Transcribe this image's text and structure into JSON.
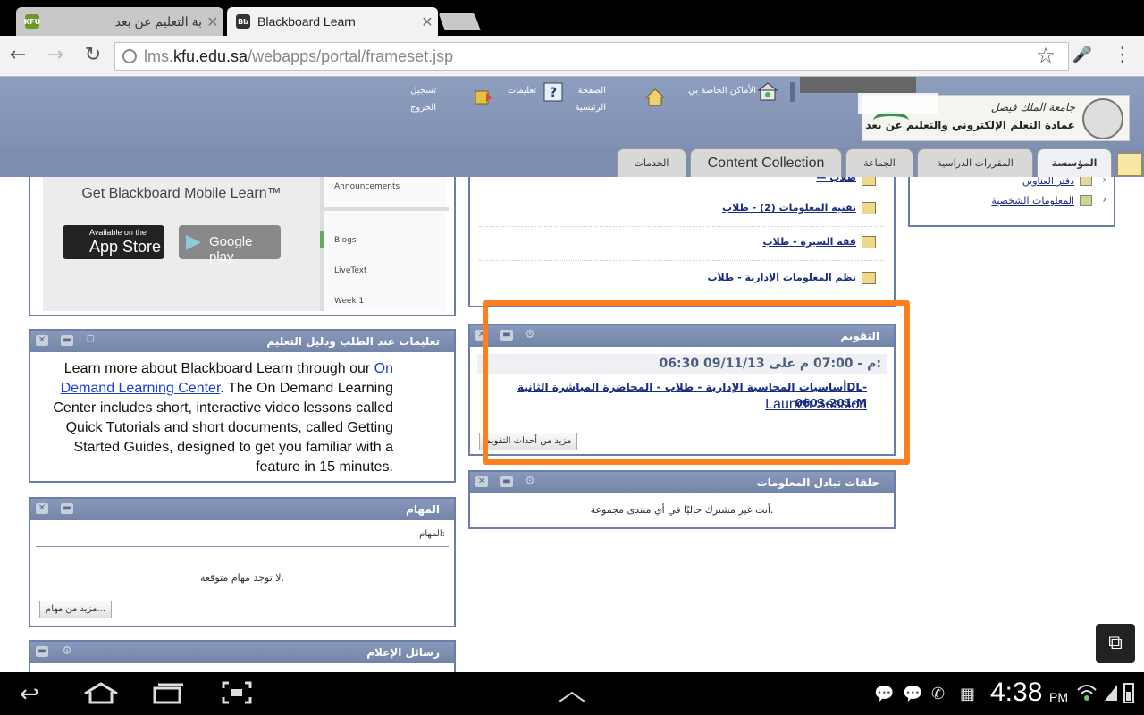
{
  "browser": {
    "tabs": [
      {
        "title": "بة التعليم عن بعد",
        "favicon": "KFU"
      },
      {
        "title": "Blackboard Learn",
        "favicon": "Bb"
      }
    ],
    "url_prefix": "lms.",
    "url_domain": "kfu.edu.sa",
    "url_path": "/webapps/portal/frameset.jsp"
  },
  "header": {
    "links": {
      "logout": [
        "تسجيل",
        "الخروج"
      ],
      "help": "تعليمات",
      "home": [
        "الصفحة",
        "الرئيسية"
      ],
      "my_places": "الأماكن الخاصة بي"
    },
    "logo_line1": "جامعة الملك فيصل",
    "logo_line2": "عمادة التعلم الإلكتروني والتعليم عن بعد",
    "tabs": {
      "institution": "المؤسسة",
      "courses": "المقررات الدراسية",
      "community": "الجماعة",
      "content_collection": "Content Collection",
      "services": "الخدمات"
    }
  },
  "right_tools": {
    "items": [
      "دفتر العناوين",
      "المعلومات الشخصية"
    ]
  },
  "courses_module": {
    "items": [
      "تقنية المعلومات (2) - طلاب",
      "فقة السيرة - طلاب",
      "نظم المعلومات الإدارية - طلاب"
    ]
  },
  "calendar": {
    "title": "التقويم",
    "datetime": "06:30 م - 07:00 م على 09/11/13:",
    "event": "أساسيات المحاسبة الإدارية - طلاب - المحاضرة المباشرة الثانيةDL-0603-201-M",
    "launch": "Launch Session",
    "more_button": "مزيد من أحداث التقويم"
  },
  "discussion": {
    "title": "حلقات تبادل المعلومات",
    "message": "أنت غير مشترك حاليًا في أي منتدى مجموعة."
  },
  "mobile_promo": {
    "get_text": "Get Blackboard Mobile Learn™",
    "appstore_small": "Available on the",
    "appstore_big": "App Store",
    "googleplay": "Google play",
    "phone_items": [
      "Announcements",
      "Blogs",
      "LiveText",
      "Week 1"
    ]
  },
  "learning_help": {
    "title": "تعليمات عند الطلب ودليل التعليم",
    "text_before": "Learn more about Blackboard Learn through our ",
    "link": "On Demand Learning Center",
    "text_after": ". The On Demand Learning Center includes short, interactive video lessons called Quick Tutorials and short documents, called Getting Started Guides, designed to get you familiar with a feature in 15 minutes."
  },
  "tasks": {
    "title": "المهام",
    "label": "المهام:",
    "empty": "لا توجد مهام متوقعة.",
    "more_button": "مزيد من مهام..."
  },
  "media": {
    "title": "رسائل الإعلام"
  },
  "system": {
    "time": "4:38",
    "ampm": "PM"
  },
  "colors": {
    "header_blue": "#7c8db0",
    "module_border": "#6b7ea7",
    "highlight_orange": "#ff7f1f",
    "link_blue": "#1a2c80"
  }
}
